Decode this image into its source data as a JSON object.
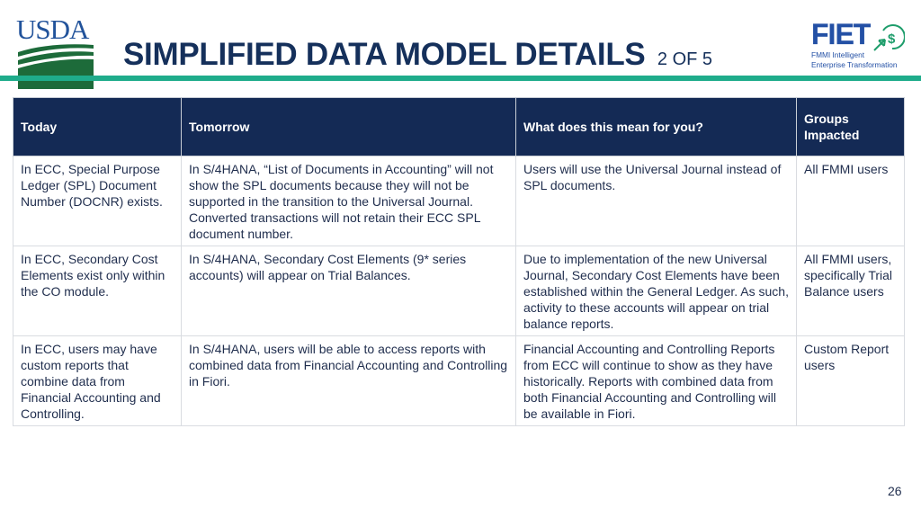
{
  "header": {
    "usda_logo_text": "USDA",
    "title": "SIMPLIFIED DATA MODEL DETAILS",
    "title_suffix": "2 OF 5",
    "fiet_logo": {
      "name": "FIET",
      "subtitle_line1": "FMMI Intelligent",
      "subtitle_line2": "Enterprise Transformation"
    },
    "accent_color": "#1fac8b",
    "title_color": "#15305b"
  },
  "table": {
    "header_color": "#142a55",
    "columns": [
      "Today",
      "Tomorrow",
      "What does this mean for you?",
      "Groups Impacted"
    ],
    "rows": [
      {
        "today": "In ECC, Special Purpose Ledger (SPL) Document Number (DOCNR) exists.",
        "tomorrow": "In S/4HANA, “List of Documents in Accounting” will not show the SPL documents because they will not be supported in the transition to the Universal Journal. Converted transactions will not retain their ECC SPL document number.",
        "meaning": "Users will use the Universal Journal instead of SPL documents.",
        "groups": "All FMMI users"
      },
      {
        "today": "In ECC, Secondary Cost Elements exist only within the CO module.",
        "tomorrow": "In S/4HANA, Secondary Cost Elements (9* series accounts) will appear on Trial Balances.",
        "meaning": "Due to implementation of the new Universal Journal, Secondary Cost Elements have been established within the General Ledger. As such, activity to these accounts will appear on trial balance reports.",
        "groups": "All FMMI users, specifically Trial Balance users"
      },
      {
        "today": "In ECC, users may have custom reports that combine data from Financial Accounting and Controlling.",
        "tomorrow": "In S/4HANA, users will be able to access reports with combined data from Financial Accounting and Controlling in Fiori.",
        "meaning": "Financial Accounting and Controlling Reports from ECC will continue to show as they have historically. Reports with combined data from both Financial Accounting and Controlling will be available in Fiori.",
        "groups": "Custom Report users"
      }
    ]
  },
  "footer": {
    "page_number": "26"
  }
}
